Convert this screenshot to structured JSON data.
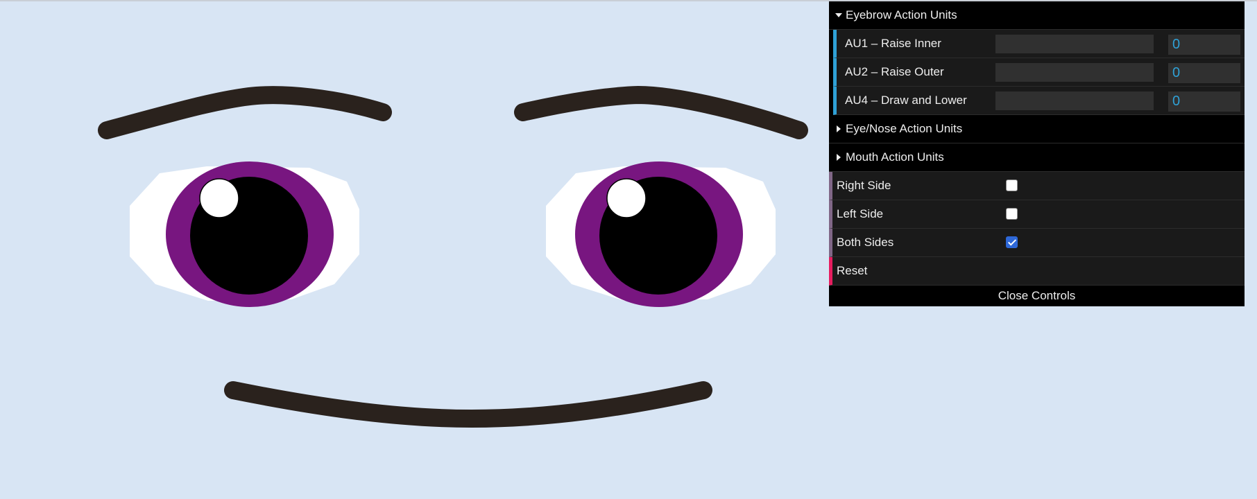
{
  "colors": {
    "background": "#d8e5f4",
    "brow": "#2a221d",
    "mouth": "#2a221d",
    "sclera": "#ffffff",
    "iris": "#781680",
    "pupil": "#000000",
    "highlight": "#ffffff",
    "number_accent": "#2fa1d6",
    "boolean_accent": "#806787",
    "function_accent": "#e61d5f"
  },
  "gui": {
    "eyebrow_folder": {
      "title": "Eyebrow Action Units",
      "expanded": true,
      "controls": [
        {
          "label": "AU1 – Raise Inner",
          "value": "0"
        },
        {
          "label": "AU2 – Raise Outer",
          "value": "0"
        },
        {
          "label": "AU4 – Draw and Lower",
          "value": "0"
        }
      ]
    },
    "eye_nose_folder": {
      "title": "Eye/Nose Action Units",
      "expanded": false
    },
    "mouth_folder": {
      "title": "Mouth Action Units",
      "expanded": false
    },
    "right_side": {
      "label": "Right Side",
      "checked": false
    },
    "left_side": {
      "label": "Left Side",
      "checked": false
    },
    "both_sides": {
      "label": "Both Sides",
      "checked": true
    },
    "reset": {
      "label": "Reset"
    },
    "close": {
      "label": "Close Controls"
    }
  }
}
